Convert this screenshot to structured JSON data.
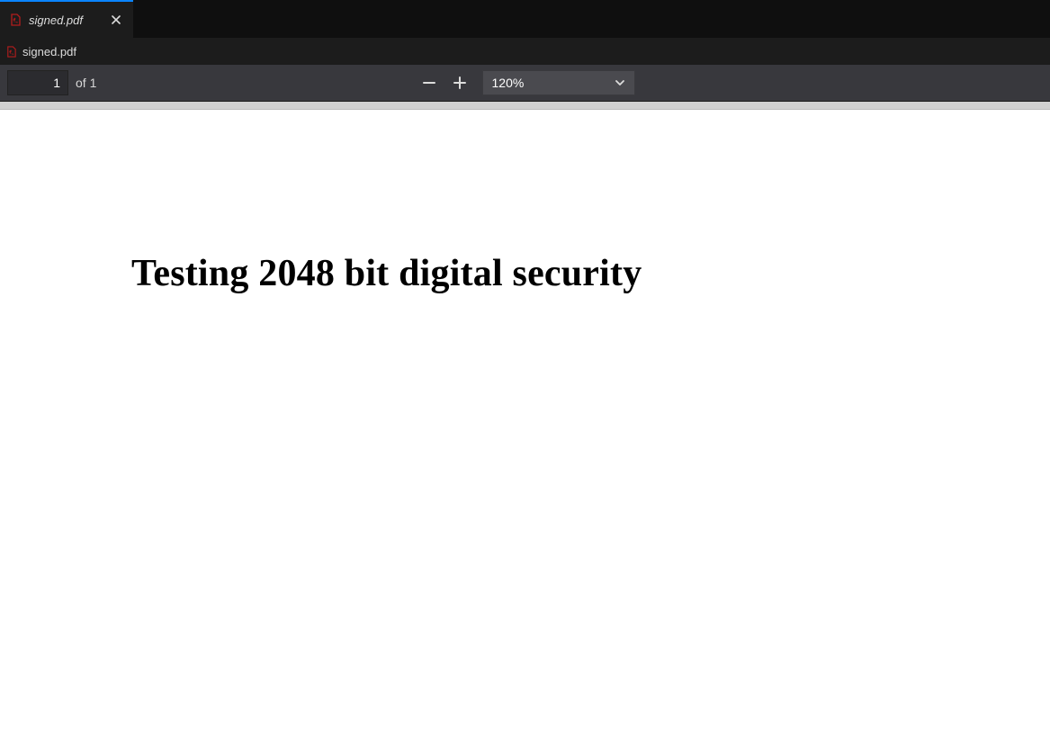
{
  "tab": {
    "title": "signed.pdf"
  },
  "file": {
    "name": "signed.pdf"
  },
  "toolbar": {
    "page_current": "1",
    "page_total": "of 1",
    "zoom_value": "120%"
  },
  "document": {
    "heading": "Testing 2048 bit digital security"
  }
}
